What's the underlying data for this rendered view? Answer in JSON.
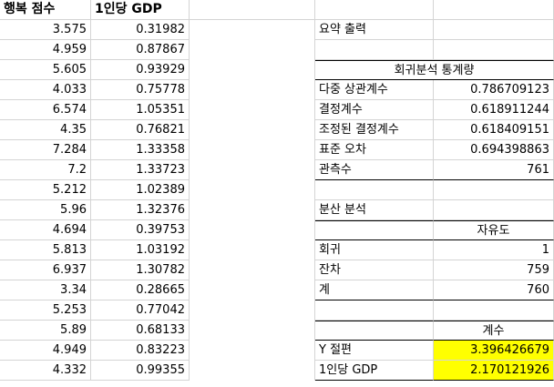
{
  "columns": {
    "a": "행복 점수",
    "b": "1인당 GDP"
  },
  "rows": [
    [
      "3.575",
      "0.31982"
    ],
    [
      "4.959",
      "0.87867"
    ],
    [
      "5.605",
      "0.93929"
    ],
    [
      "4.033",
      "0.75778"
    ],
    [
      "6.574",
      "1.05351"
    ],
    [
      "4.35",
      "0.76821"
    ],
    [
      "7.284",
      "1.33358"
    ],
    [
      "7.2",
      "1.33723"
    ],
    [
      "5.212",
      "1.02389"
    ],
    [
      "5.96",
      "1.32376"
    ],
    [
      "4.694",
      "0.39753"
    ],
    [
      "5.813",
      "1.03192"
    ],
    [
      "6.937",
      "1.30782"
    ],
    [
      "3.34",
      "0.28665"
    ],
    [
      "5.253",
      "0.77042"
    ],
    [
      "5.89",
      "0.68133"
    ],
    [
      "4.949",
      "0.83223"
    ],
    [
      "4.332",
      "0.99355"
    ]
  ],
  "summary": {
    "title": "요약 출력",
    "regression_stats_title": "회귀분석 통계량",
    "regression_stats": [
      {
        "label": "다중 상관계수",
        "value": "0.786709123"
      },
      {
        "label": "결정계수",
        "value": "0.618911244"
      },
      {
        "label": "조정된 결정계수",
        "value": "0.618409151"
      },
      {
        "label": "표준 오차",
        "value": "0.694398863"
      },
      {
        "label": "관측수",
        "value": "761"
      }
    ],
    "anova_title": "분산 분석",
    "anova_header": "자유도",
    "anova": [
      {
        "label": "회귀",
        "value": "1"
      },
      {
        "label": "잔차",
        "value": "759"
      },
      {
        "label": "계",
        "value": "760"
      }
    ],
    "coef_header": "계수",
    "coefficients": [
      {
        "label": "Y 절편",
        "value": "3.396426679"
      },
      {
        "label": "1인당 GDP",
        "value": "2.170121926"
      }
    ]
  },
  "highlight_color": "#ffff00"
}
